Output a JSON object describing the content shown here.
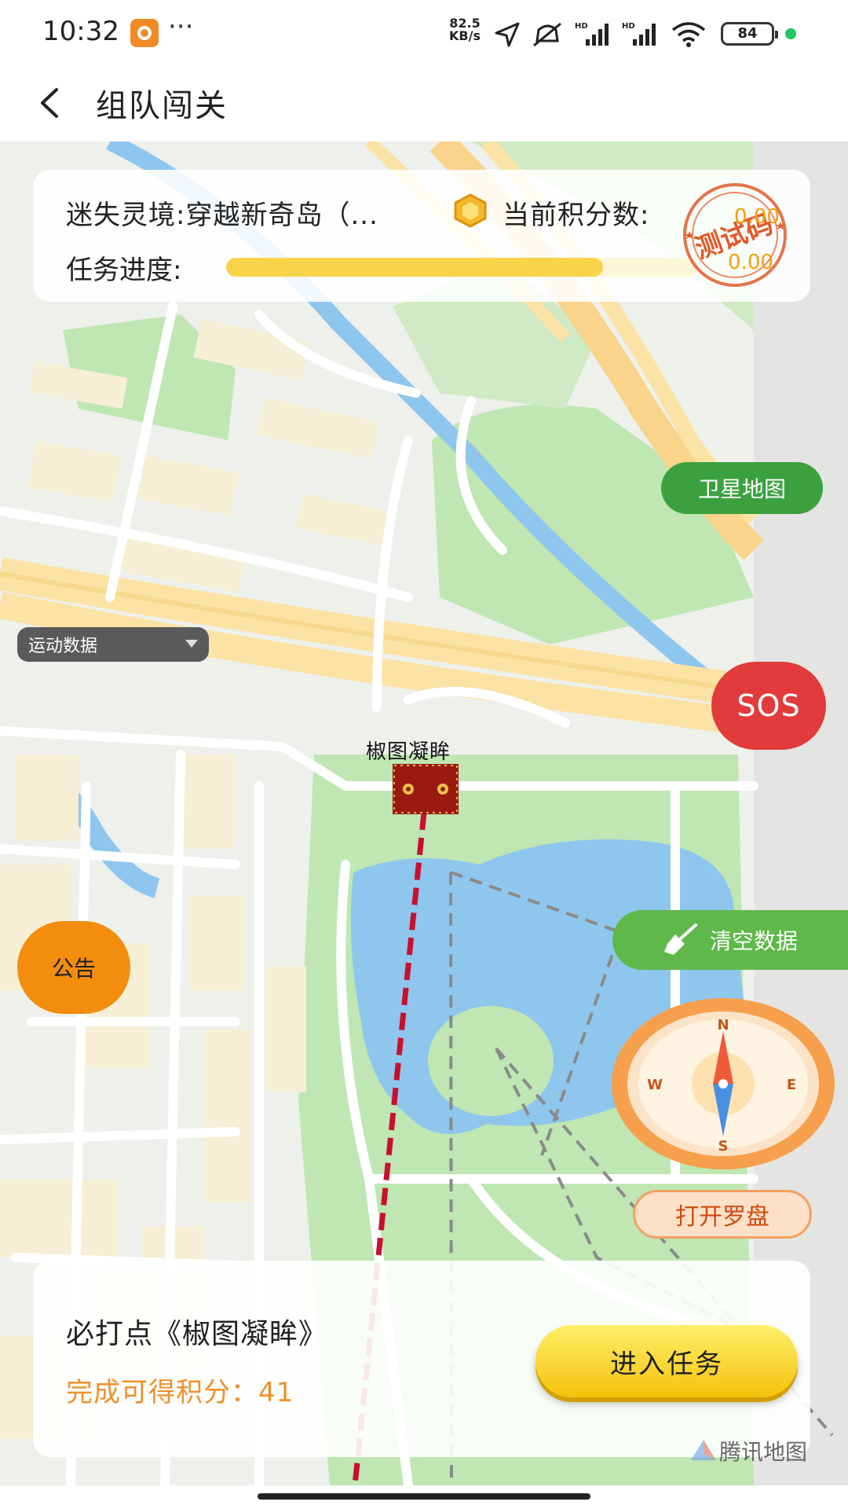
{
  "status_bar": {
    "time": "10:32",
    "more": "···",
    "net_speed_value": "82.5",
    "net_speed_unit": "KB/s",
    "battery": "84"
  },
  "nav": {
    "title": "组队闯关"
  },
  "info_card": {
    "level_name": "迷失灵境:穿越新奇岛（...",
    "score_label": "当前积分数:",
    "progress_label": "任务进度:",
    "progress_fraction": 0.8,
    "stamp_text": "测试码",
    "stamp_values": [
      "0.00",
      "0.00"
    ]
  },
  "map_controls": {
    "satellite": "卫星地图",
    "sport_data": "运动数据",
    "sos": "SOS",
    "notice": "公告",
    "clear_data": "清空数据",
    "open_compass": "打开罗盘",
    "compass_letters": {
      "n": "N",
      "s": "S",
      "e": "E",
      "w": "W"
    }
  },
  "marker": {
    "label": "椒图凝眸"
  },
  "task_card": {
    "title": "必打点《椒图凝眸》",
    "reward": "完成可得积分：41",
    "enter_button": "进入任务"
  },
  "map_logo": "腾讯地图",
  "icons": [
    "back-icon",
    "app-badge-icon",
    "location-arrow-icon",
    "mute-icon",
    "signal-icon",
    "wifi-icon",
    "battery-icon",
    "coin-icon",
    "broom-icon",
    "compass-icon",
    "treasure-marker-icon",
    "tencent-map-logo-icon"
  ],
  "colors": {
    "satellite_green": "#3aa13e",
    "sos_red": "#e23b3b",
    "notice_orange": "#f38d0e",
    "clear_green": "#5fb84a",
    "reward_orange": "#f0902a",
    "route_red": "#c8102e"
  }
}
